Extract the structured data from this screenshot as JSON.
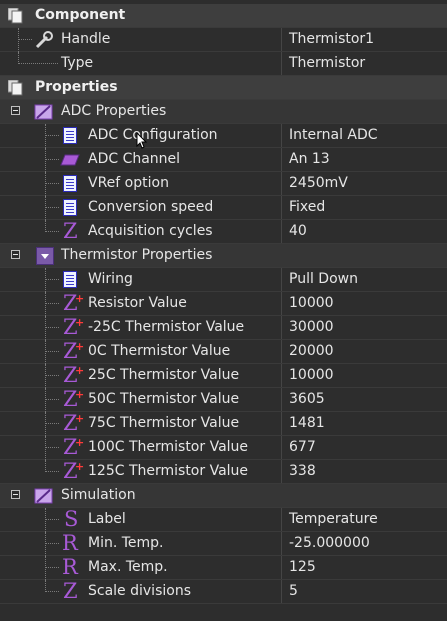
{
  "component": {
    "title": "Component",
    "rows": [
      {
        "label": "Handle",
        "value": "Thermistor1",
        "icon": "wrench-icon"
      },
      {
        "label": "Type",
        "value": "Thermistor",
        "icon": ""
      }
    ]
  },
  "properties": {
    "title": "Properties",
    "adc": {
      "title": "ADC Properties",
      "rows": [
        {
          "label": "ADC Configuration",
          "value": "Internal ADC",
          "icon": "document-icon"
        },
        {
          "label": "ADC Channel",
          "value": "An 13",
          "icon": "channel-icon"
        },
        {
          "label": "VRef option",
          "value": "2450mV",
          "icon": "document-icon"
        },
        {
          "label": "Conversion speed",
          "value": "Fixed",
          "icon": "document-icon"
        },
        {
          "label": "Acquisition cycles",
          "value": "40",
          "icon": "z-icon"
        }
      ]
    },
    "thermistor": {
      "title": "Thermistor Properties",
      "rows": [
        {
          "label": "Wiring",
          "value": "Pull Down",
          "icon": "document-icon"
        },
        {
          "label": "Resistor Value",
          "value": "10000",
          "icon": "z-plus-icon"
        },
        {
          "label": "-25C Thermistor Value",
          "value": "30000",
          "icon": "z-plus-icon"
        },
        {
          "label": "0C Thermistor Value",
          "value": "20000",
          "icon": "z-plus-icon"
        },
        {
          "label": "25C Thermistor Value",
          "value": "10000",
          "icon": "z-plus-icon"
        },
        {
          "label": "50C Thermistor Value",
          "value": "3605",
          "icon": "z-plus-icon"
        },
        {
          "label": "75C Thermistor Value",
          "value": "1481",
          "icon": "z-plus-icon"
        },
        {
          "label": "100C Thermistor Value",
          "value": "677",
          "icon": "z-plus-icon"
        },
        {
          "label": "125C Thermistor Value",
          "value": "338",
          "icon": "z-plus-icon"
        }
      ]
    },
    "simulation": {
      "title": "Simulation",
      "rows": [
        {
          "label": "Label",
          "value": "Temperature",
          "icon": "s-icon"
        },
        {
          "label": "Min. Temp.",
          "value": "-25.000000",
          "icon": "r-icon"
        },
        {
          "label": "Max. Temp.",
          "value": "125",
          "icon": "r-icon"
        },
        {
          "label": "Scale divisions",
          "value": "5",
          "icon": "z-icon"
        }
      ]
    }
  },
  "colors": {
    "background": "#2d2d2d",
    "section": "#3e3e3e",
    "accent": "#a85ad6",
    "plus": "#ff3a3a"
  }
}
